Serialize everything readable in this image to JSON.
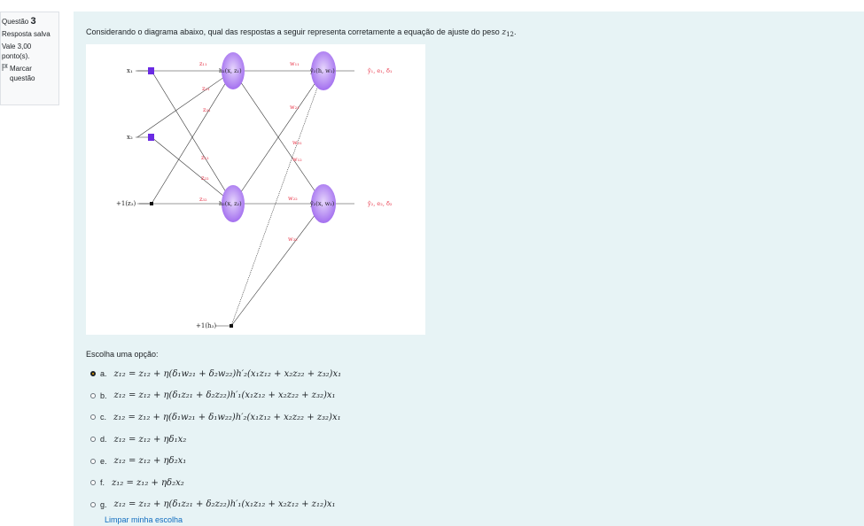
{
  "info": {
    "label": "Questão",
    "number": "3",
    "status": "Resposta salva",
    "grade": "Vale 3,00 ponto(s).",
    "flag_icon": "flag-icon",
    "flag": "Marcar questão"
  },
  "question": {
    "text": "Considerando o diagrama abaixo, qual das respostas a seguir representa corretamente a equação de ajuste do peso",
    "var": "z",
    "var_sub": "12",
    "end": "."
  },
  "diagram": {
    "inputs": [
      "x₁",
      "x₂",
      "+1(z₃)"
    ],
    "bias2": "+1(h₃)",
    "hidden": [
      "h₁(x, z₁)",
      "h₂(x, z₂)"
    ],
    "outputs": [
      "ŷ₁(h, w₁)",
      "ŷ₂(x, w₂)"
    ],
    "output_labels": [
      "ŷ₁, e₁, δ₁",
      "ŷ₂, e₂, δ₂"
    ],
    "z_weights": [
      "z₁₁",
      "z₂₁",
      "z₃₁",
      "z₁₂",
      "z₂₂",
      "z₃₂"
    ],
    "w_weights": [
      "w₁₁",
      "w₂₁",
      "w₃₁",
      "w₁₂",
      "w₂₂",
      "w₃₂"
    ],
    "colors": {
      "node": "#9f6af0",
      "node_light": "#d9c2fb",
      "input": "#6a2be3",
      "weight": "#e8374a"
    }
  },
  "prompt": "Escolha uma opção:",
  "options": [
    {
      "letter": "a.",
      "eq": "z₁₂ = z₁₂ + η(δ₁w₂₁ + δ₂w₂₂)h′₂(x₁z₁₂ + x₂z₂₂ + z₃₂)x₁"
    },
    {
      "letter": "b.",
      "eq": "z₁₂ = z₁₂ + η(δ₁z₂₁ + δ₂z₂₂)h′₁(x₁z₁₂ + x₂z₂₂ + z₃₂)x₁"
    },
    {
      "letter": "c.",
      "eq": "z₁₂ = z₁₂ + η(δ₁w₂₁ + δ₁w₂₂)h′₂(x₁z₁₂ + x₂z₂₂ + z₃₂)x₁"
    },
    {
      "letter": "d.",
      "eq": "z₁₂ = z₁₂ + ηδ₁x₂"
    },
    {
      "letter": "e.",
      "eq": "z₁₂ = z₁₂ + ηδ₂x₁"
    },
    {
      "letter": "f.",
      "eq": "z₁₂ = z₁₂ + ηδ₂x₂"
    },
    {
      "letter": "g.",
      "eq": "z₁₂ = z₁₂ + η(δ₁z₂₁ + δ₂z₂₂)h′₁(x₁z₁₂ + x₂z₁₂ + z₁₂)x₁"
    }
  ],
  "selected": 0,
  "clear": "Limpar minha escolha"
}
